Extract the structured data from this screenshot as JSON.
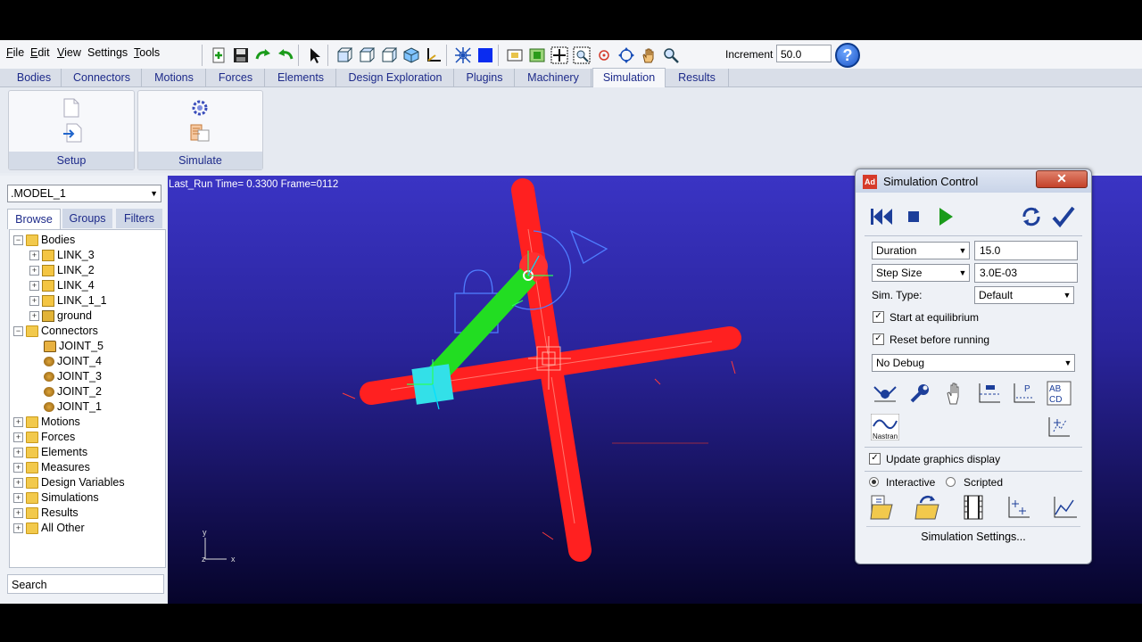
{
  "menu": {
    "file": "ile",
    "file_u": "F",
    "edit": "dit",
    "edit_u": "E",
    "view": "iew",
    "view_u": "V",
    "settings": "Settings",
    "tools": "ools",
    "tools_u": "T"
  },
  "toolbar": {
    "increment_label": "Increment",
    "increment_value": "50.0",
    "help": "?"
  },
  "tabs": [
    "Bodies",
    "Connectors",
    "Motions",
    "Forces",
    "Elements",
    "Design Exploration",
    "Plugins",
    "Machinery",
    "Simulation",
    "Results"
  ],
  "active_tab": "Simulation",
  "ribbon": {
    "setup_label": "Setup",
    "simulate_label": "Simulate"
  },
  "left_panel": {
    "model": ".MODEL_1",
    "browse_tabs": [
      "Browse",
      "Groups",
      "Filters"
    ],
    "tree": {
      "bodies": "Bodies",
      "link3": "LINK_3",
      "link2": "LINK_2",
      "link4": "LINK_4",
      "link11": "LINK_1_1",
      "ground": "ground",
      "connectors": "Connectors",
      "joint5": "JOINT_5",
      "joint4": "JOINT_4",
      "joint3": "JOINT_3",
      "joint2": "JOINT_2",
      "joint1": "JOINT_1",
      "motions": "Motions",
      "forces": "Forces",
      "elements": "Elements",
      "measures": "Measures",
      "design_variables": "Design Variables",
      "simulations": "Simulations",
      "results": "Results",
      "all_other": "All Other"
    },
    "search": "Search"
  },
  "viewport": {
    "status": "Last_Run   Time= 0.3300 Frame=0112",
    "triad_y": "y",
    "triad_x": "x",
    "triad_z": "z"
  },
  "sim_control": {
    "title": "Simulation Control",
    "app_icon": "Ad",
    "duration_label": "Duration",
    "duration_value": "15.0",
    "step_label": "Step Size",
    "step_value": "3.0E-03",
    "sim_type_label": "Sim. Type:",
    "sim_type_value": "Default",
    "start_equilibrium": "Start at equilibrium",
    "reset_before_run": "Reset before running",
    "debug_value": "No Debug",
    "nastran_label": "Nastran",
    "update_graphics": "Update graphics display",
    "interactive": "Interactive",
    "scripted": "Scripted",
    "settings_button": "Simulation Settings..."
  },
  "colors": {
    "viewport_top": "#3a34c4",
    "link_red": "#ff2020",
    "link_green": "#22dd22",
    "block_cyan": "#33e0e8"
  }
}
